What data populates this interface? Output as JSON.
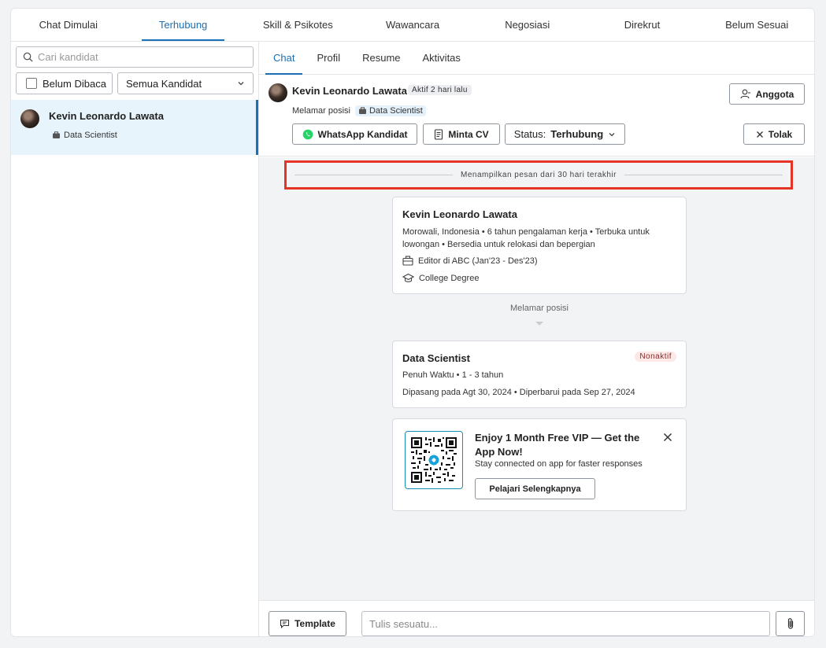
{
  "top_tabs": [
    {
      "label": "Chat Dimulai"
    },
    {
      "label": "Terhubung",
      "active": true
    },
    {
      "label": "Skill & Psikotes"
    },
    {
      "label": "Wawancara"
    },
    {
      "label": "Negosiasi"
    },
    {
      "label": "Direkrut"
    },
    {
      "label": "Belum Sesuai"
    }
  ],
  "sidebar": {
    "search_placeholder": "Cari kandidat",
    "unread_filter_label": "Belum Dibaca",
    "candidate_filter_value": "Semua Kandidat",
    "candidates": [
      {
        "name": "Kevin Leonardo Lawata",
        "job": "Data Scientist",
        "selected": true
      }
    ]
  },
  "sub_tabs": [
    {
      "label": "Chat",
      "active": true
    },
    {
      "label": "Profil"
    },
    {
      "label": "Resume"
    },
    {
      "label": "Aktivitas"
    }
  ],
  "header": {
    "name": "Kevin Leonardo Lawata",
    "status": "Aktif 2 hari lalu",
    "applied_label": "Melamar posisi",
    "applied_job": "Data Scientist",
    "members_button": "Anggota",
    "whatsapp_button": "WhatsApp Kandidat",
    "request_cv_button": "Minta CV",
    "status_label": "Status:",
    "status_value": "Terhubung",
    "reject_button": "Tolak"
  },
  "chat": {
    "history_notice": "Menampilkan pesan dari 30 hari terakhir",
    "profile_card": {
      "name": "Kevin Leonardo Lawata",
      "summary": "Morowali, Indonesia • 6 tahun pengalaman kerja • Terbuka untuk lowongan • Bersedia untuk relokasi dan bepergian",
      "experience": "Editor di ABC (Jan'23 - Des'23)",
      "education": "College Degree"
    },
    "applied_position_label": "Melamar posisi",
    "job_card": {
      "title": "Data Scientist",
      "badge": "Nonaktif",
      "meta": "Penuh Waktu • 1 - 3 tahun",
      "dates": "Dipasang pada Agt 30, 2024 • Diperbarui pada Sep 27, 2024"
    },
    "promo_card": {
      "title": "Enjoy 1 Month Free VIP — Get the App Now!",
      "subtitle": "Stay connected on app for faster responses",
      "button": "Pelajari Selengkapnya"
    }
  },
  "composer": {
    "template_button": "Template",
    "message_placeholder": "Tulis sesuatu..."
  },
  "colors": {
    "accent": "#1a6fb5",
    "highlight_border": "#e53325",
    "whatsapp": "#25d366",
    "selected_bg": "#e8f4fc"
  }
}
